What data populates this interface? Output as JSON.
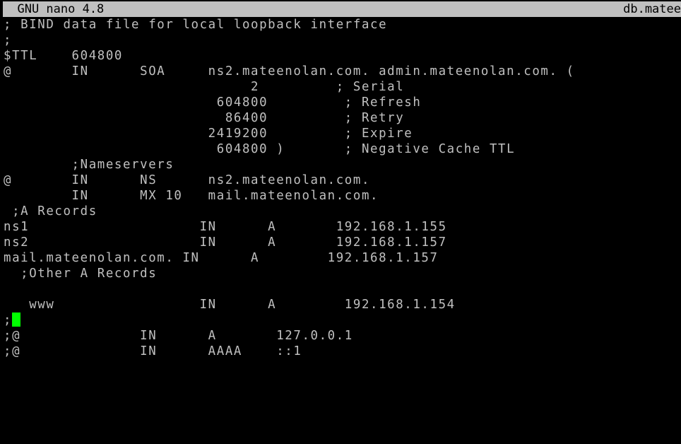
{
  "titlebar": {
    "app": "  GNU nano 4.8",
    "filename": "db.matee"
  },
  "editor": {
    "lines": [
      "; BIND data file for local loopback interface",
      ";",
      "$TTL    604800",
      "@       IN      SOA     ns2.mateenolan.com. admin.mateenolan.com. (",
      "                             2         ; Serial",
      "                         604800         ; Refresh",
      "                          86400         ; Retry",
      "                        2419200         ; Expire",
      "                         604800 )       ; Negative Cache TTL",
      "        ;Nameservers",
      "@       IN      NS      ns2.mateenolan.com.",
      "        IN      MX 10   mail.mateenolan.com.",
      " ;A Records",
      "ns1                    IN      A       192.168.1.155",
      "ns2                    IN      A       192.168.1.157",
      "mail.mateenolan.com. IN      A        192.168.1.157",
      "  ;Other A Records",
      "",
      "   www                 IN      A        192.168.1.154",
      ";",
      ";@              IN      A       127.0.0.1",
      ";@              IN      AAAA    ::1"
    ],
    "cursor_line": 19
  },
  "colors": {
    "background": "#000000",
    "text": "#c0c0c0",
    "titlebar_bg": "#c0c0c0",
    "cursor": "#00ff00"
  }
}
